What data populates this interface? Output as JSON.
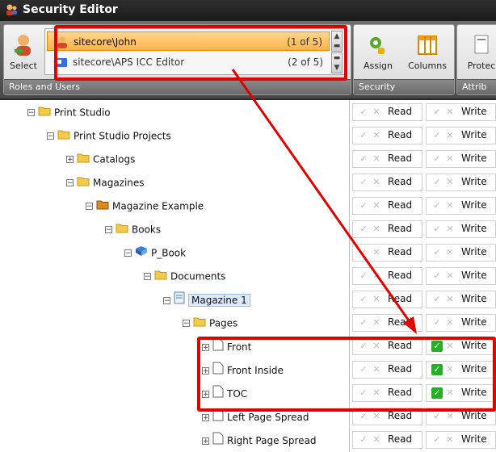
{
  "window": {
    "title": "Security Editor"
  },
  "ribbon": {
    "select_label": "Select",
    "users": [
      {
        "name": "sitecore\\John",
        "position": "(1 of 5)"
      },
      {
        "name": "sitecore\\APS ICC Editor",
        "position": "(2 of 5)"
      }
    ],
    "group_roles": "Roles and Users",
    "assign_label": "Assign",
    "columns_label": "Columns",
    "group_security": "Security",
    "protect_label": "Protec",
    "group_attrib": "Attrib"
  },
  "permissions": {
    "read": "Read",
    "write": "Write"
  },
  "tree": [
    {
      "label": "Print Studio",
      "expander": "⊟",
      "icon": "folder-icon",
      "write_on": false
    },
    {
      "label": "Print Studio Projects",
      "expander": "⊟",
      "icon": "folder-icon",
      "write_on": false
    },
    {
      "label": "Catalogs",
      "expander": "⊞",
      "icon": "folder-icon",
      "write_on": false
    },
    {
      "label": "Magazines",
      "expander": "⊟",
      "icon": "folder-icon",
      "write_on": false
    },
    {
      "label": "Magazine Example",
      "expander": "⊟",
      "icon": "magazine-folder-icon",
      "write_on": false
    },
    {
      "label": "Books",
      "expander": "⊟",
      "icon": "folder-icon",
      "write_on": false
    },
    {
      "label": "P_Book",
      "expander": "⊟",
      "icon": "book-icon",
      "write_on": false
    },
    {
      "label": "Documents",
      "expander": "⊟",
      "icon": "folder-icon",
      "write_on": false
    },
    {
      "label": "Magazine 1",
      "expander": "⊟",
      "icon": "document-icon",
      "write_on": false
    },
    {
      "label": "Pages",
      "expander": "⊟",
      "icon": "folder-icon",
      "write_on": false
    },
    {
      "label": "Front",
      "expander": "⊞",
      "icon": "page-icon",
      "write_on": true
    },
    {
      "label": "Front Inside",
      "expander": "⊞",
      "icon": "page-icon",
      "write_on": true
    },
    {
      "label": "TOC",
      "expander": "⊞",
      "icon": "page-icon",
      "write_on": true
    },
    {
      "label": "Left Page Spread",
      "expander": "⊞",
      "icon": "page-icon",
      "write_on": false
    },
    {
      "label": "Right Page Spread",
      "expander": "⊞",
      "icon": "page-icon",
      "write_on": false
    }
  ],
  "colors": {
    "highlight": "#e00000",
    "check_on": "#24b024",
    "selected_user": "#ffc36a"
  }
}
